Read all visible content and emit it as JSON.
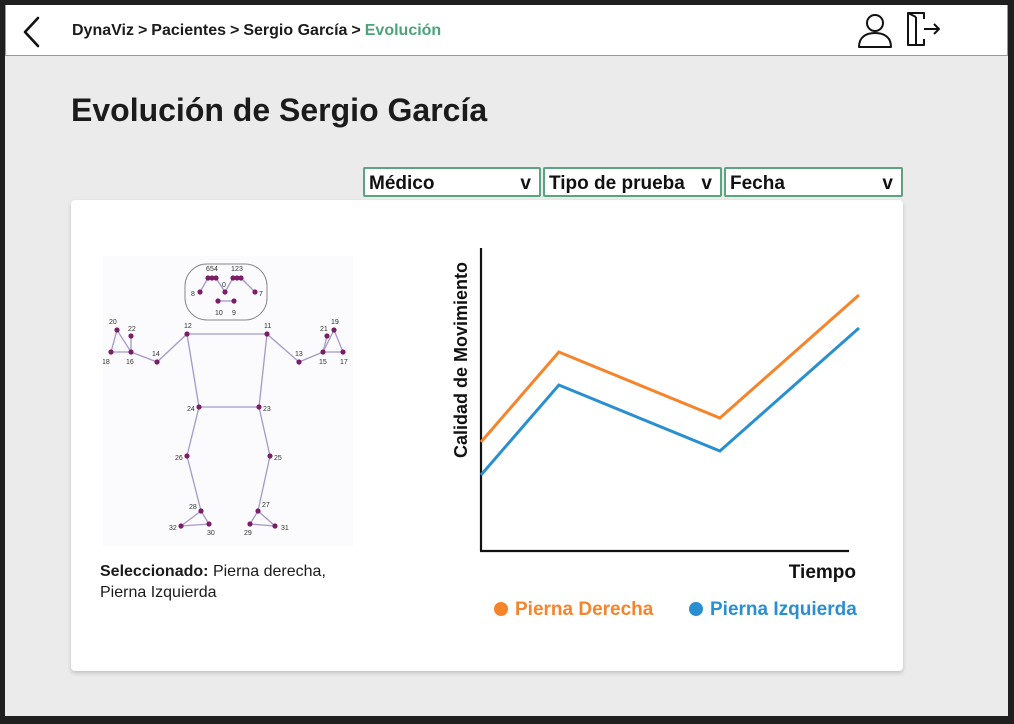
{
  "breadcrumb": {
    "items": [
      "DynaViz",
      "Pacientes",
      "Sergio García"
    ],
    "separator": ">",
    "current": "Evolución"
  },
  "page": {
    "title": "Evolución de Sergio García"
  },
  "filters": {
    "medico": {
      "label": "Médico",
      "caret": "v"
    },
    "tipo": {
      "label": "Tipo de prueba",
      "caret": "v"
    },
    "fecha": {
      "label": "Fecha",
      "caret": "v"
    }
  },
  "selection": {
    "label": "Seleccionado:",
    "value": "Pierna derecha, Pierna Izquierda"
  },
  "skeleton": {
    "keypoints": [
      "0",
      "1",
      "2",
      "3",
      "4",
      "5",
      "6",
      "7",
      "8",
      "9",
      "10",
      "11",
      "12",
      "13",
      "14",
      "15",
      "16",
      "17",
      "18",
      "19",
      "20",
      "21",
      "22",
      "23",
      "24",
      "25",
      "26",
      "27",
      "28",
      "29",
      "30",
      "31",
      "32"
    ]
  },
  "colors": {
    "accent": "#4aa37a",
    "keypoint": "#7a1f66",
    "bone": "#a39acb",
    "series_right": "#f5842b",
    "series_left": "#2a8fd1"
  },
  "icons": {
    "back": "chevron-left-icon",
    "user": "user-icon",
    "logout": "logout-icon"
  },
  "chart_data": {
    "type": "line",
    "xlabel": "Tiempo",
    "ylabel": "Calidad de Movimiento",
    "x": [
      0,
      1,
      2,
      3
    ],
    "ylim": [
      0,
      1
    ],
    "grid": false,
    "legend_position": "bottom",
    "series": [
      {
        "name": "Pierna Derecha",
        "color": "#f5842b",
        "values": [
          0.36,
          0.66,
          0.44,
          0.85
        ]
      },
      {
        "name": "Pierna Izquierda",
        "color": "#2a8fd1",
        "values": [
          0.25,
          0.55,
          0.33,
          0.74
        ]
      }
    ]
  }
}
